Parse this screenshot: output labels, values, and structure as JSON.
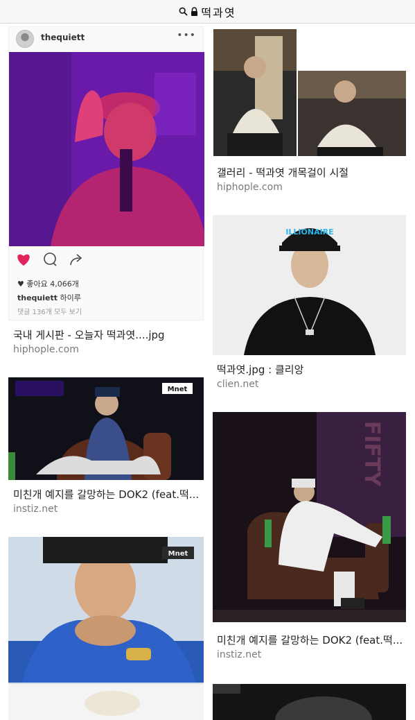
{
  "address_bar": {
    "url_text": "떡과엿",
    "search_icon": "search-icon",
    "lock_icon": "lock-icon"
  },
  "results": [
    {
      "caption": "국내 게시판 - 오늘자 떡과엿....jpg",
      "source": "hiphople.com",
      "instagram": {
        "username": "thequiett",
        "likes": "좋아요 4,066개",
        "caption_user": "thequiett",
        "caption_text": "하이루",
        "comments": "댓글 136개 모두 보기",
        "more": "•••"
      }
    },
    {
      "caption": "갤러리 - 떡과엿 개목걸이 시절",
      "source": "hiphople.com"
    },
    {
      "caption": "떡과엿.jpg : 클리앙",
      "source": "clien.net",
      "cap_text": "ILLIONAIRE"
    },
    {
      "caption": "미친개 예지를 갈망하는 DOK2 (feat.떡...",
      "source": "instiz.net",
      "badge": "Mnet"
    },
    {
      "caption": "미친개 예지를 갈망하는 DOK2 (feat.떡...",
      "source": "instiz.net",
      "wall_text": "FIFTY"
    },
    {
      "caption": "",
      "source": "",
      "badge": "Mnet"
    }
  ],
  "colors": {
    "caption": "#222222",
    "source": "#7a7a7a",
    "heart": "#e0245e"
  }
}
